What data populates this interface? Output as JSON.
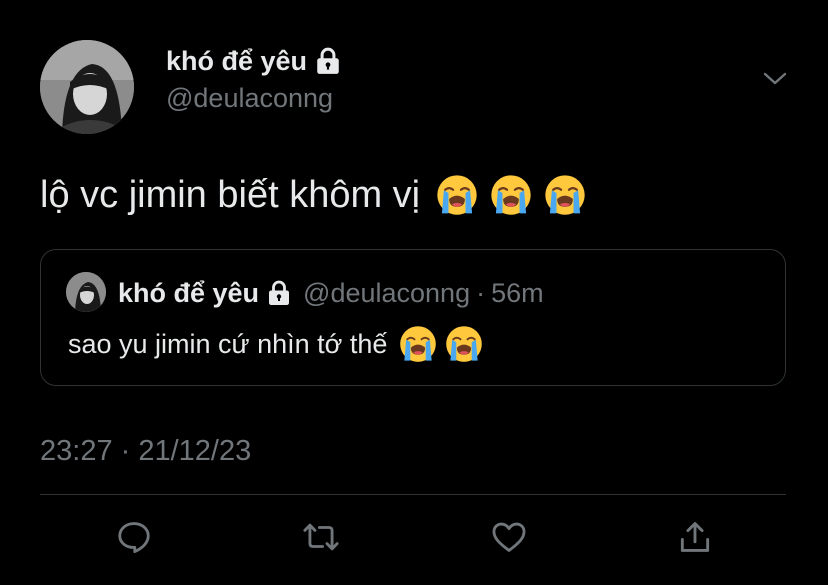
{
  "tweet": {
    "display_name": "khó để yêu",
    "handle": "@deulaconng",
    "text": "lộ vc jimin biết khôm vị",
    "emojis": [
      "loudly-crying-face",
      "loudly-crying-face",
      "loudly-crying-face"
    ],
    "timestamp": "23:27 · 21/12/23"
  },
  "quoted_tweet": {
    "display_name": "khó để yêu",
    "handle": "@deulaconng",
    "separator": "·",
    "time": "56m",
    "text": "sao yu jimin cứ nhìn tớ thế",
    "emojis": [
      "loudly-crying-face",
      "loudly-crying-face"
    ]
  },
  "actions": [
    "reply-icon",
    "retweet-icon",
    "like-icon",
    "share-icon"
  ],
  "colors": {
    "background": "#000000",
    "primary_text": "#e7e9ea",
    "secondary_text": "#71767b",
    "border": "#2f3336"
  }
}
